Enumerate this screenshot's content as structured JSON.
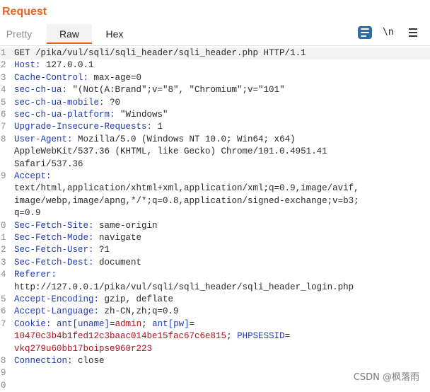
{
  "panel": {
    "title": "Request"
  },
  "tabs": {
    "pretty": "Pretty",
    "raw": "Raw",
    "hex": "Hex"
  },
  "toolbar": {
    "wrap_icon": "text-wrap-icon",
    "newline_label": "\\n",
    "menu_icon": "hamburger-menu-icon"
  },
  "colors": {
    "accent": "#e8641f",
    "header_key": "#1f3ab8",
    "cookie_value": "#b2121b",
    "icon_button": "#2e6da4"
  },
  "lines": [
    {
      "n": "1",
      "k": "",
      "v": "GET /pika/vul/sqli/sqli_header/sqli_header.php HTTP/1.1"
    },
    {
      "n": "2",
      "k": "Host:",
      "v": " 127.0.0.1"
    },
    {
      "n": "3",
      "k": "Cache-Control:",
      "v": " max-age=0"
    },
    {
      "n": "4",
      "k": "sec-ch-ua:",
      "v": " \"(Not(A:Brand\";v=\"8\", \"Chromium\";v=\"101\""
    },
    {
      "n": "5",
      "k": "sec-ch-ua-mobile:",
      "v": " ?0"
    },
    {
      "n": "6",
      "k": "sec-ch-ua-platform:",
      "v": " \"Windows\""
    },
    {
      "n": "7",
      "k": "Upgrade-Insecure-Requests:",
      "v": " 1"
    },
    {
      "n": "8",
      "k": "User-Agent:",
      "v": " Mozilla/5.0 (Windows NT 10.0; Win64; x64)"
    },
    {
      "n": "",
      "k": "",
      "v": "AppleWebKit/537.36 (KHTML, like Gecko) Chrome/101.0.4951.41"
    },
    {
      "n": "",
      "k": "",
      "v": "Safari/537.36"
    },
    {
      "n": "9",
      "k": "Accept:",
      "v": ""
    },
    {
      "n": "",
      "k": "",
      "v": "text/html,application/xhtml+xml,application/xml;q=0.9,image/avif,"
    },
    {
      "n": "",
      "k": "",
      "v": "image/webp,image/apng,*/*;q=0.8,application/signed-exchange;v=b3;"
    },
    {
      "n": "",
      "k": "",
      "v": "q=0.9"
    },
    {
      "n": "0",
      "k": "Sec-Fetch-Site:",
      "v": " same-origin"
    },
    {
      "n": "1",
      "k": "Sec-Fetch-Mode:",
      "v": " navigate"
    },
    {
      "n": "2",
      "k": "Sec-Fetch-User:",
      "v": " ?1"
    },
    {
      "n": "3",
      "k": "Sec-Fetch-Dest:",
      "v": " document"
    },
    {
      "n": "4",
      "k": "Referer:",
      "v": ""
    },
    {
      "n": "",
      "k": "",
      "v": "http://127.0.0.1/pika/vul/sqli/sqli_header/sqli_header_login.php"
    },
    {
      "n": "5",
      "k": "Accept-Encoding:",
      "v": " gzip, deflate"
    },
    {
      "n": "6",
      "k": "Accept-Language:",
      "v": " zh-CN,zh;q=0.9"
    },
    {
      "n": "7",
      "k": "Cookie:",
      "v": " ",
      "cookie": [
        {
          "t": "ck",
          "s": "ant[uname]"
        },
        {
          "t": "p",
          "s": "="
        },
        {
          "t": "cv",
          "s": "admin"
        },
        {
          "t": "p",
          "s": "; "
        },
        {
          "t": "ck",
          "s": "ant[pw]"
        },
        {
          "t": "p",
          "s": "="
        }
      ]
    },
    {
      "n": "",
      "k": "",
      "v": "",
      "cookie": [
        {
          "t": "cv",
          "s": "10470c3b4b1fed12c3baac014be15fac67c6e815"
        },
        {
          "t": "p",
          "s": "; "
        },
        {
          "t": "ck",
          "s": "PHPSESSID"
        },
        {
          "t": "p",
          "s": "="
        }
      ]
    },
    {
      "n": "",
      "k": "",
      "v": "",
      "cookie": [
        {
          "t": "cv",
          "s": "vkq279u60bb17boipse960r223"
        }
      ]
    },
    {
      "n": "8",
      "k": "Connection:",
      "v": " close"
    },
    {
      "n": "9",
      "k": "",
      "v": ""
    },
    {
      "n": "0",
      "k": "",
      "v": ""
    }
  ],
  "watermark": "CSDN @枫落雨"
}
